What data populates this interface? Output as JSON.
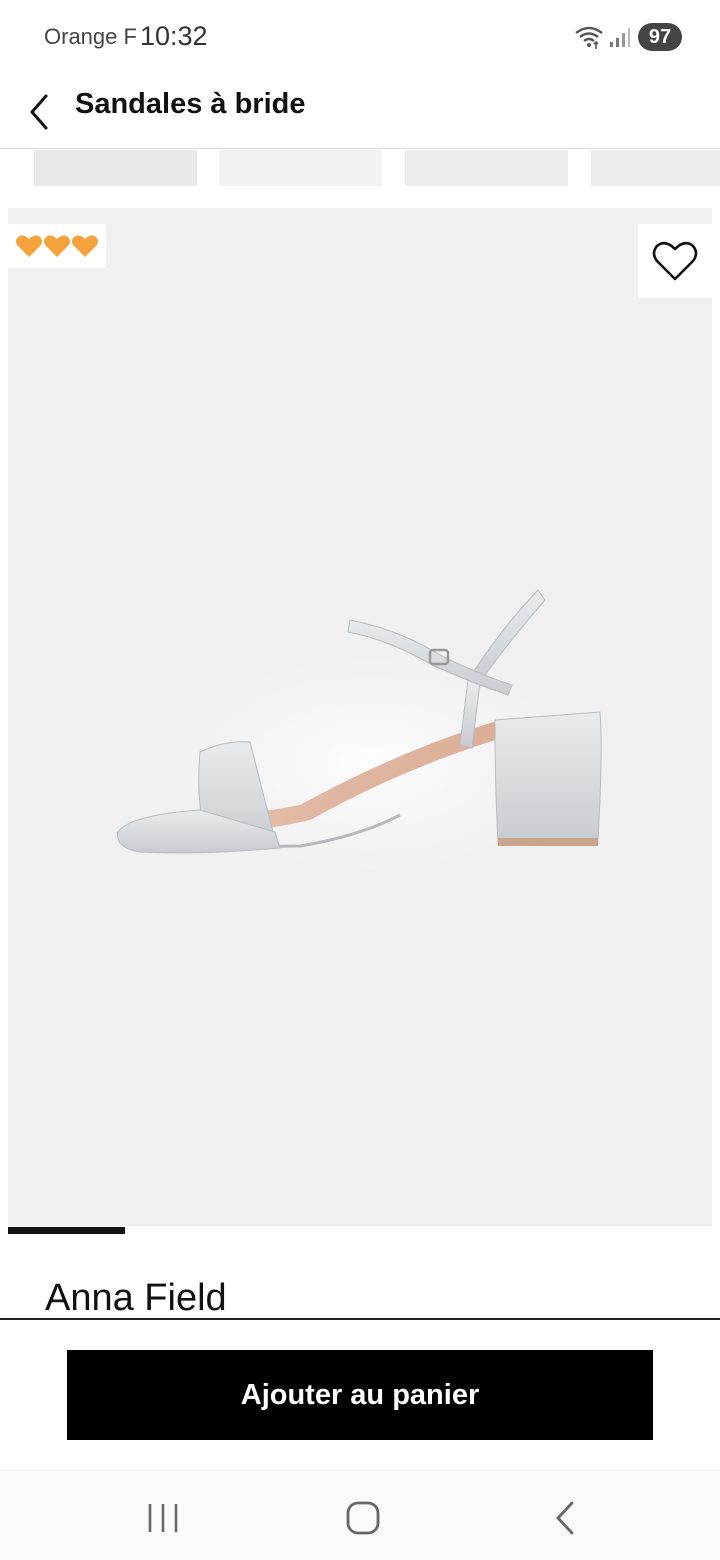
{
  "status_bar": {
    "carrier": "Orange F",
    "time": "10:32",
    "battery": "97"
  },
  "header": {
    "title": "Sandales à bride",
    "back_icon": "chevron-left-icon"
  },
  "product": {
    "rating_badge": "🧡🧡🧡",
    "brand": "Anna Field",
    "wishlist_icon": "heart-outline-icon",
    "image_subject": "silver-glitter-sandal"
  },
  "gallery": {
    "thumbnail_count": 4,
    "active_index": 1,
    "total_images": 6
  },
  "actions": {
    "add_to_cart_label": "Ajouter au panier"
  },
  "nav_bar": {
    "icons": [
      "recents-icon",
      "home-icon",
      "back-icon"
    ]
  },
  "colors": {
    "accent": "#000000",
    "image_bg": "#f0f0f0",
    "heart_emoji": "#f5a13c"
  }
}
